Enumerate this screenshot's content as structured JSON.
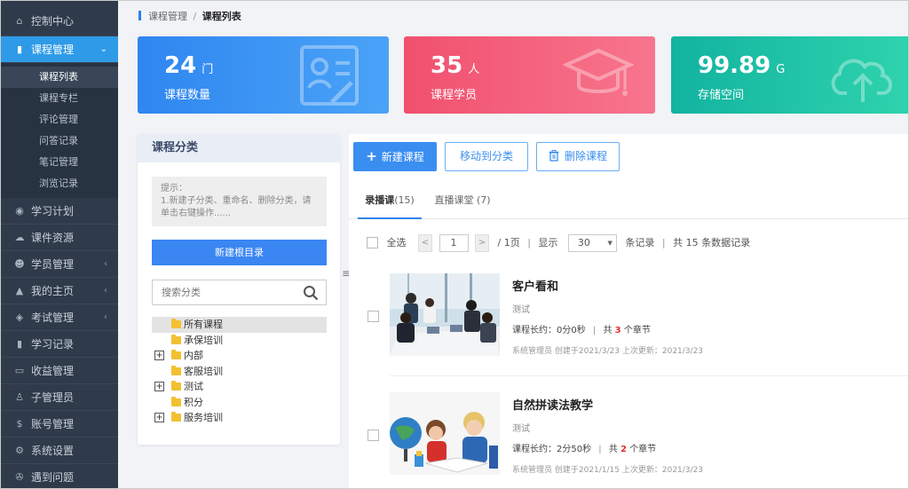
{
  "sidebar": {
    "items": [
      {
        "label": "控制中心",
        "icon": "home-icon",
        "has_arrow": false
      },
      {
        "label": "课程管理",
        "icon": "book-icon",
        "has_arrow": true,
        "active": true
      },
      {
        "label": "学习计划",
        "icon": "eye-icon",
        "has_arrow": false
      },
      {
        "label": "课件资源",
        "icon": "cloud-icon",
        "has_arrow": false
      },
      {
        "label": "学员管理",
        "icon": "users-icon",
        "has_arrow": true
      },
      {
        "label": "我的主页",
        "icon": "graduation-cap-icon",
        "has_arrow": true
      },
      {
        "label": "考试管理",
        "icon": "tag-icon",
        "has_arrow": true
      },
      {
        "label": "学习记录",
        "icon": "book-icon",
        "has_arrow": false
      },
      {
        "label": "收益管理",
        "icon": "card-icon",
        "has_arrow": false
      },
      {
        "label": "子管理员",
        "icon": "user-icon",
        "has_arrow": false
      },
      {
        "label": "账号管理",
        "icon": "dollar-icon",
        "has_arrow": false
      },
      {
        "label": "系统设置",
        "icon": "gear-icon",
        "has_arrow": false
      },
      {
        "label": "遇到问题",
        "icon": "help-icon",
        "has_arrow": false
      }
    ],
    "sub_items": [
      "课程列表",
      "课程专栏",
      "评论管理",
      "问答记录",
      "笔记管理",
      "浏览记录"
    ],
    "active_sub": 0
  },
  "breadcrumb": {
    "parent": "课程管理",
    "separator": "/",
    "current": "课程列表"
  },
  "stats": [
    {
      "value": "24",
      "unit": "门",
      "label": "课程数量",
      "color": "#2f86f0"
    },
    {
      "value": "35",
      "unit": "人",
      "label": "课程学员",
      "color": "#f0506e"
    },
    {
      "value": "99.89",
      "unit": "G",
      "label": "存储空间",
      "color": "#12b3a0"
    }
  ],
  "category": {
    "title": "课程分类",
    "tip_title": "提示：",
    "tip_text": "1.新建子分类、重命名、删除分类，请单击右键操作......",
    "new_root_label": "新建根目录",
    "search_placeholder": "搜索分类",
    "tree": [
      {
        "label": "所有课程",
        "expandable": false,
        "selected": true
      },
      {
        "label": "承保培训",
        "expandable": false
      },
      {
        "label": "内部",
        "expandable": true
      },
      {
        "label": "客服培训",
        "expandable": false
      },
      {
        "label": "测试",
        "expandable": true
      },
      {
        "label": "积分",
        "expandable": false
      },
      {
        "label": "服务培训",
        "expandable": true
      }
    ]
  },
  "toolbar": {
    "new_label": "新建课程",
    "move_label": "移动到分类",
    "delete_label": "删除课程"
  },
  "tabs": [
    {
      "label": "录播课",
      "count": "(15)",
      "active": true
    },
    {
      "label": "直播课堂 (7)",
      "active": false
    }
  ],
  "pager": {
    "select_all": "全选",
    "prev": "<",
    "page": "1",
    "next": ">",
    "total_pages": "/ 1页",
    "show_label": "显示",
    "page_size": "30",
    "records_label": "条记录",
    "total_label": "共 15 条数据记录"
  },
  "courses": [
    {
      "title": "客户看和",
      "desc": "测试",
      "duration_label": "课程长约：0分0秒",
      "chapters_prefix": "共",
      "chapters": "3",
      "chapters_suffix": "个章节",
      "footer": "系统管理员 创建于2021/3/23 上次更新：2021/3/23"
    },
    {
      "title": "自然拼读法教学",
      "desc": "测试",
      "duration_label": "课程长约：2分50秒",
      "chapters_prefix": "共",
      "chapters": "2",
      "chapters_suffix": "个章节",
      "footer": "系统管理员 创建于2021/1/15 上次更新：2021/3/23"
    }
  ]
}
